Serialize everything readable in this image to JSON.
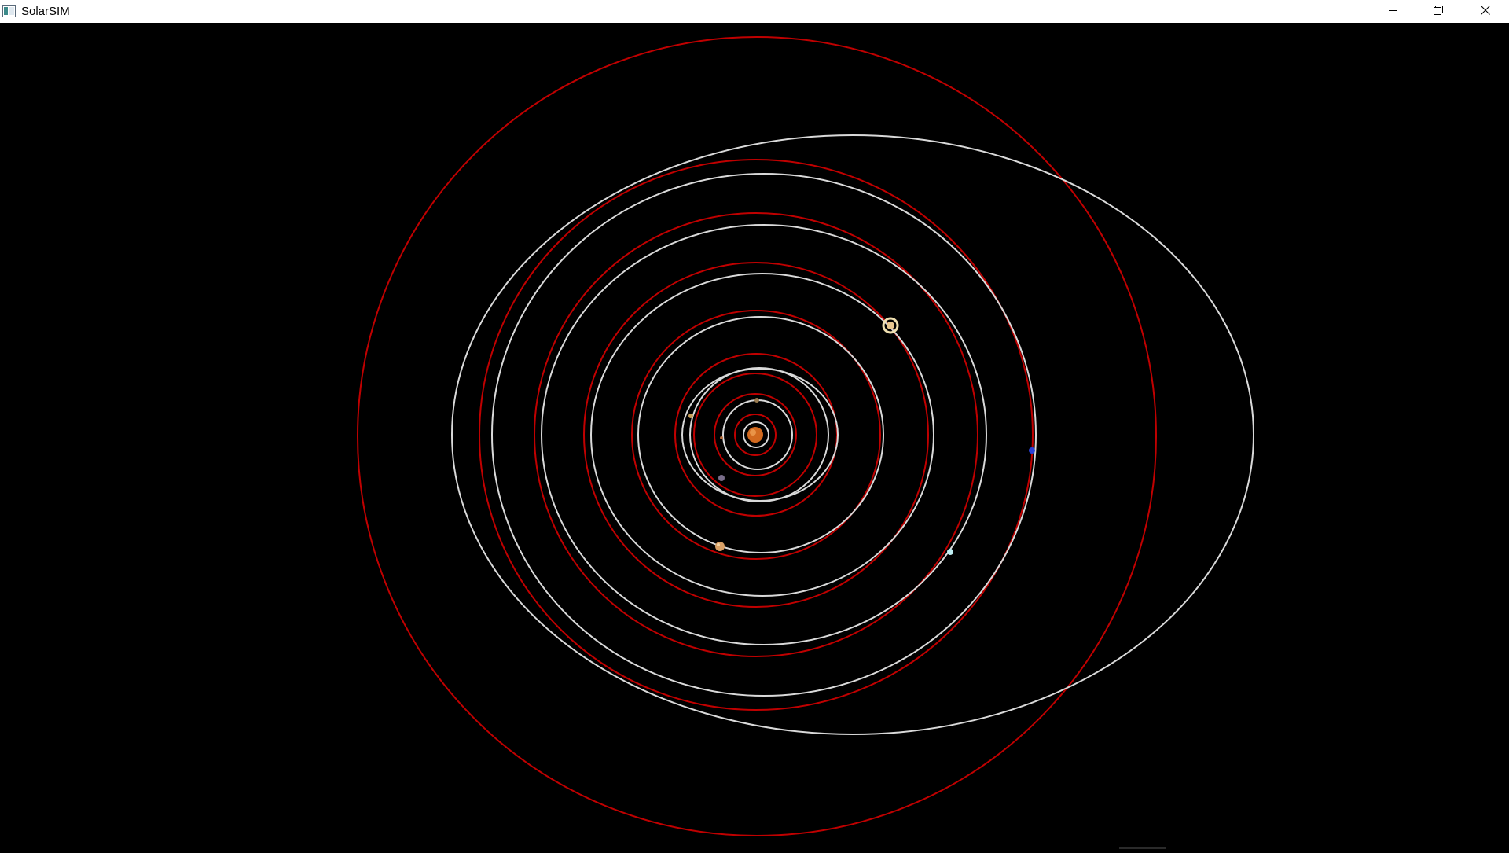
{
  "window": {
    "title": "SolarSIM",
    "icons": {
      "app": "solarsim-app-icon",
      "minimize": "minimize-icon",
      "maximize": "restore-icon",
      "close": "close-icon"
    }
  },
  "scene": {
    "background_color": "#000000",
    "orbit_colors": {
      "predicted": "#c00000",
      "trail": "#d9d9d9"
    },
    "sun": {
      "name": "sun",
      "color": "#d2691e"
    },
    "bodies": [
      {
        "name": "mercury",
        "color": "#9a7b4f"
      },
      {
        "name": "venus",
        "color": "#c8a15a"
      },
      {
        "name": "earth",
        "color": "#7a6d8a"
      },
      {
        "name": "mars",
        "color": "#b06a3a"
      },
      {
        "name": "jupiter",
        "color": "#d8a066"
      },
      {
        "name": "saturn",
        "color": "#f0e0b0"
      },
      {
        "name": "uranus",
        "color": "#bfeef2"
      },
      {
        "name": "neptune",
        "color": "#2b40d9"
      }
    ]
  }
}
